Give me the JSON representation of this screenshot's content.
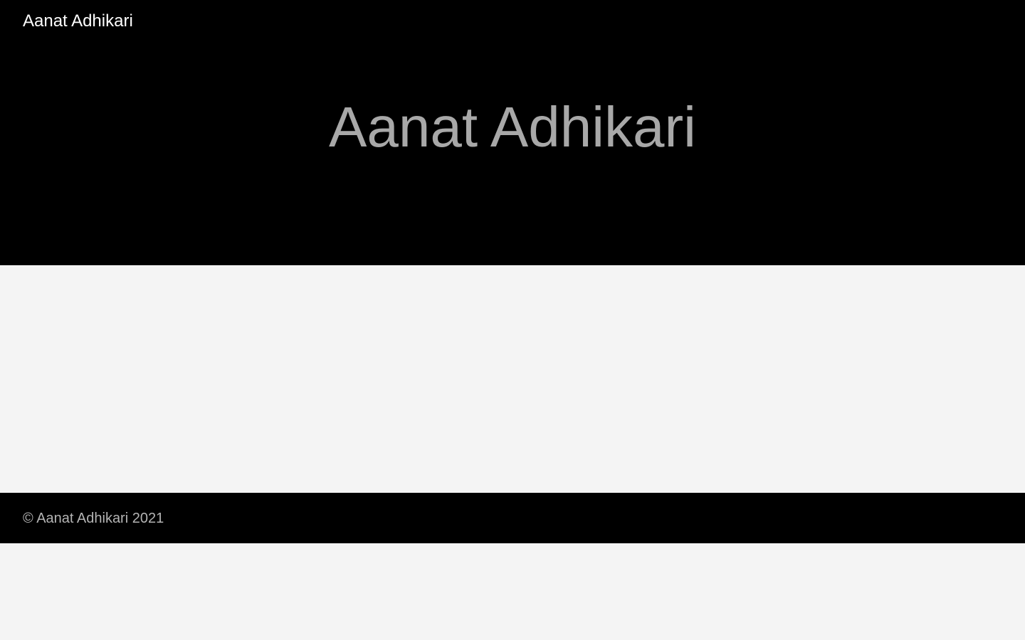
{
  "header": {
    "site_name": "Aanat Adhikari"
  },
  "hero": {
    "title": "Aanat Adhikari"
  },
  "footer": {
    "copyright": "© Aanat Adhikari 2021"
  },
  "colors": {
    "header_background": "#000000",
    "page_background": "#f4f4f4",
    "site_name_text": "#ffffff",
    "hero_title_text": "#a8a8a8",
    "footer_text": "#b4b4b4"
  }
}
